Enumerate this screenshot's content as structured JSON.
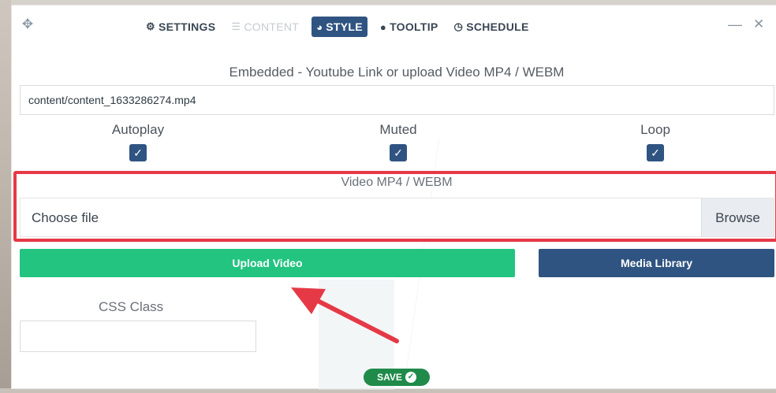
{
  "tabs": [
    {
      "icon": "gear-icon",
      "glyph": "⚙",
      "label": "SETTINGS"
    },
    {
      "icon": "content-icon",
      "glyph": "☰",
      "label": "CONTENT"
    },
    {
      "icon": "palette-icon",
      "glyph": "◕",
      "label": "STYLE"
    },
    {
      "icon": "comment-icon",
      "glyph": "●",
      "label": "TOOLTIP"
    },
    {
      "icon": "clock-icon",
      "glyph": "◷",
      "label": "SCHEDULE"
    }
  ],
  "window": {
    "move_glyph": "✥",
    "minimize_glyph": "—",
    "close_glyph": "✕"
  },
  "embed": {
    "label": "Embedded - Youtube Link or upload Video MP4 / WEBM",
    "value": "content/content_1633286274.mp4"
  },
  "options": {
    "autoplay": {
      "label": "Autoplay",
      "checked": true
    },
    "muted": {
      "label": "Muted",
      "checked": true
    },
    "loop": {
      "label": "Loop",
      "checked": true
    }
  },
  "checkmark": "✓",
  "video_file": {
    "label": "Video MP4 / WEBM",
    "placeholder": "Choose file",
    "browse_label": "Browse"
  },
  "buttons": {
    "upload": "Upload Video",
    "media_library": "Media Library",
    "save": "SAVE"
  },
  "css_class": {
    "label": "CSS Class",
    "value": ""
  },
  "colors": {
    "accent_blue": "#2f5482",
    "upload_green": "#22c480",
    "save_green": "#1f8a4a",
    "highlight_red": "#e53946"
  }
}
